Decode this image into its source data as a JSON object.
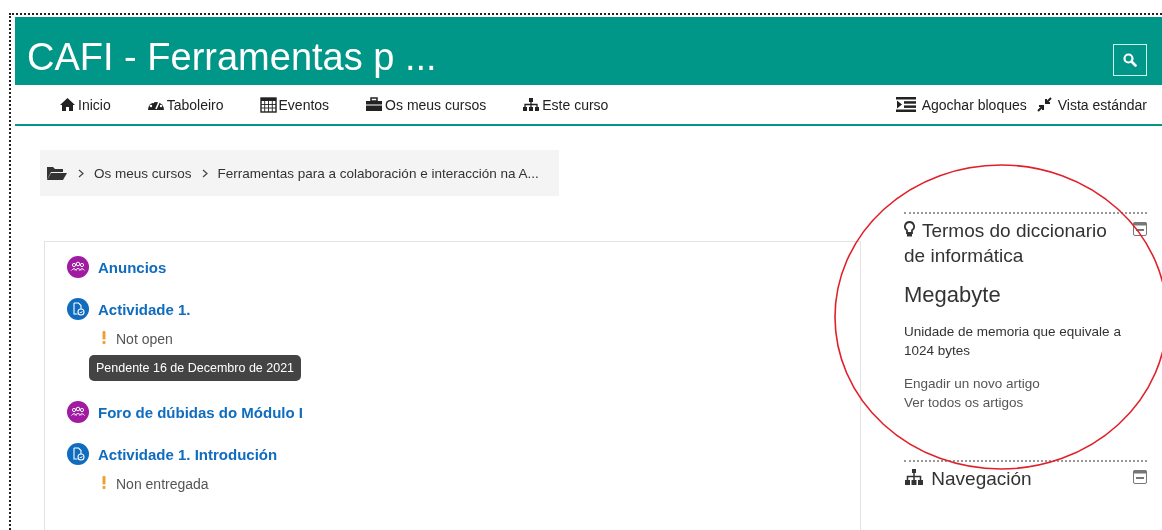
{
  "header": {
    "title": "CAFI - Ferramentas p ..."
  },
  "nav": {
    "items": [
      {
        "label": "Inicio"
      },
      {
        "label": "Taboleiro"
      },
      {
        "label": "Eventos"
      },
      {
        "label": "Os meus cursos"
      },
      {
        "label": "Este curso"
      }
    ],
    "right_items": [
      {
        "label": "Agochar bloques"
      },
      {
        "label": "Vista estándar"
      }
    ]
  },
  "breadcrumb": [
    "Os meus cursos",
    "Ferramentas para a colaboración e interacción na A..."
  ],
  "activities": [
    {
      "kind": "forum",
      "title": "Anuncios"
    },
    {
      "kind": "assignment",
      "title": "Actividade 1.",
      "status": "Not open",
      "tooltip": "Pendente 16 de Decembro de 2021"
    },
    {
      "kind": "forum",
      "title": "Foro de dúbidas do Módulo I"
    },
    {
      "kind": "assignment",
      "title": "Actividade 1. Introdución",
      "status": "Non entregada"
    }
  ],
  "blocks": [
    {
      "kind": "glossary",
      "title": "Termos do diccionario de informática",
      "term": "Megabyte",
      "definition": "Unidade de memoria que equivale a 1024 bytes",
      "links": [
        "Engadir un novo artigo",
        "Ver todos os artigos"
      ]
    },
    {
      "kind": "navigation",
      "title": "Navegación"
    }
  ]
}
